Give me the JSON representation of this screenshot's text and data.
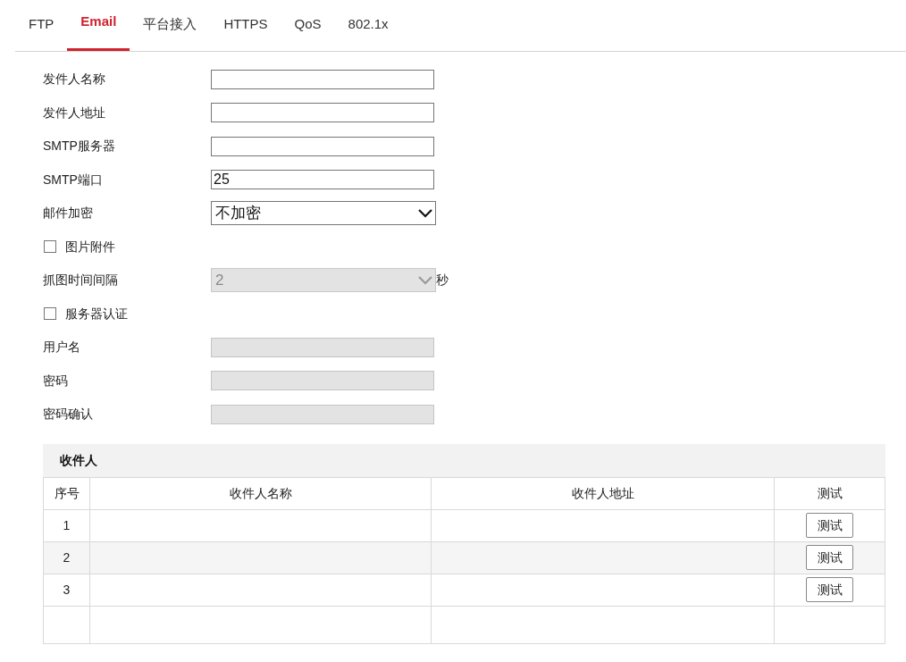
{
  "tabs": [
    {
      "label": "FTP",
      "selected": false
    },
    {
      "label": "Email",
      "selected": true
    },
    {
      "label": "平台接入",
      "selected": false
    },
    {
      "label": "HTTPS",
      "selected": false
    },
    {
      "label": "QoS",
      "selected": false
    },
    {
      "label": "802.1x",
      "selected": false
    }
  ],
  "form": [
    {
      "kind": "text",
      "label": "发件人名称",
      "disabled": false
    },
    {
      "kind": "text",
      "label": "发件人地址",
      "disabled": false
    },
    {
      "kind": "text",
      "label": "SMTP服务器",
      "disabled": false
    },
    {
      "kind": "text",
      "label": "SMTP端口",
      "value": "25",
      "disabled": false
    },
    {
      "kind": "select",
      "label": "邮件加密",
      "value": "不加密",
      "disabled": false
    },
    {
      "kind": "checkbox",
      "label": "图片附件",
      "checked": false
    },
    {
      "kind": "select",
      "label": "抓图时间间隔",
      "value": "2",
      "disabled": true,
      "unit": "秒"
    },
    {
      "kind": "checkbox",
      "label": "服务器认证",
      "checked": false
    },
    {
      "kind": "text",
      "label": "用户名",
      "disabled": true
    },
    {
      "kind": "text",
      "label": "密码",
      "disabled": true
    },
    {
      "kind": "text",
      "label": "密码确认",
      "disabled": true
    }
  ],
  "recipients": {
    "title": "收件人",
    "columns": [
      "序号",
      "收件人名称",
      "收件人地址",
      "测试"
    ],
    "rows": [
      {
        "index": "1",
        "button": "测试"
      },
      {
        "index": "2",
        "button": "测试"
      },
      {
        "index": "3",
        "button": "测试"
      }
    ]
  }
}
